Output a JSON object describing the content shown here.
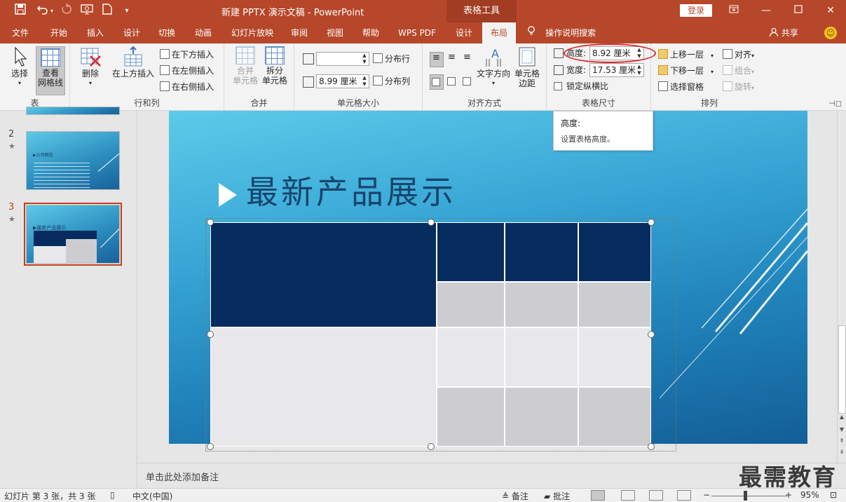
{
  "titlebar": {
    "title": "新建 PPTX 演示文稿  -  PowerPoint",
    "context_tab": "表格工具",
    "login": "登录"
  },
  "tabs": [
    "文件",
    "开始",
    "插入",
    "设计",
    "切换",
    "动画",
    "幻灯片放映",
    "审阅",
    "视图",
    "帮助",
    "WPS PDF",
    "设计",
    "布局"
  ],
  "tab_search": "操作说明搜索",
  "tab_share": "共享",
  "ribbon": {
    "table": {
      "select": "选择",
      "view_grid": "查看\n网格线",
      "label": "表"
    },
    "rows_cols": {
      "delete": "删除",
      "insert_above": "在上方插入",
      "insert_below": "在下方插入",
      "insert_left": "在左侧插入",
      "insert_right": "在右侧插入",
      "label": "行和列"
    },
    "merge": {
      "merge_cells": "合并\n单元格",
      "split_cells": "拆分\n单元格",
      "label": "合并"
    },
    "cell_size": {
      "height_value": "",
      "width_value": "8.99 厘米",
      "distribute_rows": "分布行",
      "distribute_cols": "分布列",
      "label": "单元格大小"
    },
    "alignment": {
      "text_direction": "文字方向",
      "cell_margins": "单元格\n边距",
      "label": "对齐方式"
    },
    "table_size": {
      "height_label": "高度:",
      "height_value": "8.92 厘米",
      "width_label": "宽度:",
      "width_value": "17.53 厘米",
      "lock_ratio": "锁定纵横比",
      "label": "表格尺寸"
    },
    "arrange": {
      "bring_forward": "上移一层",
      "send_backward": "下移一层",
      "selection_pane": "选择窗格",
      "align": "对齐",
      "group": "组合",
      "rotate": "旋转",
      "label": "排列"
    }
  },
  "tooltip": {
    "title": "高度:",
    "desc": "设置表格高度。"
  },
  "slides": [
    {
      "num": "2",
      "star": "★",
      "title": "▶公司概括"
    },
    {
      "num": "3",
      "star": "★",
      "title": "▶最新产品展示"
    }
  ],
  "slide": {
    "title": "最新产品展示"
  },
  "notes": "单击此处添加备注",
  "status": {
    "slide_info": "幻灯片 第 3 张，共 3 张",
    "language": "中文(中国)",
    "notes_btn": "备注",
    "comments_btn": "批注",
    "zoom": "95%"
  },
  "watermark": "最需教育",
  "colors": {
    "accent": "#b7472a",
    "table_dark": "#062b5f",
    "ellipse": "#e0282a"
  }
}
